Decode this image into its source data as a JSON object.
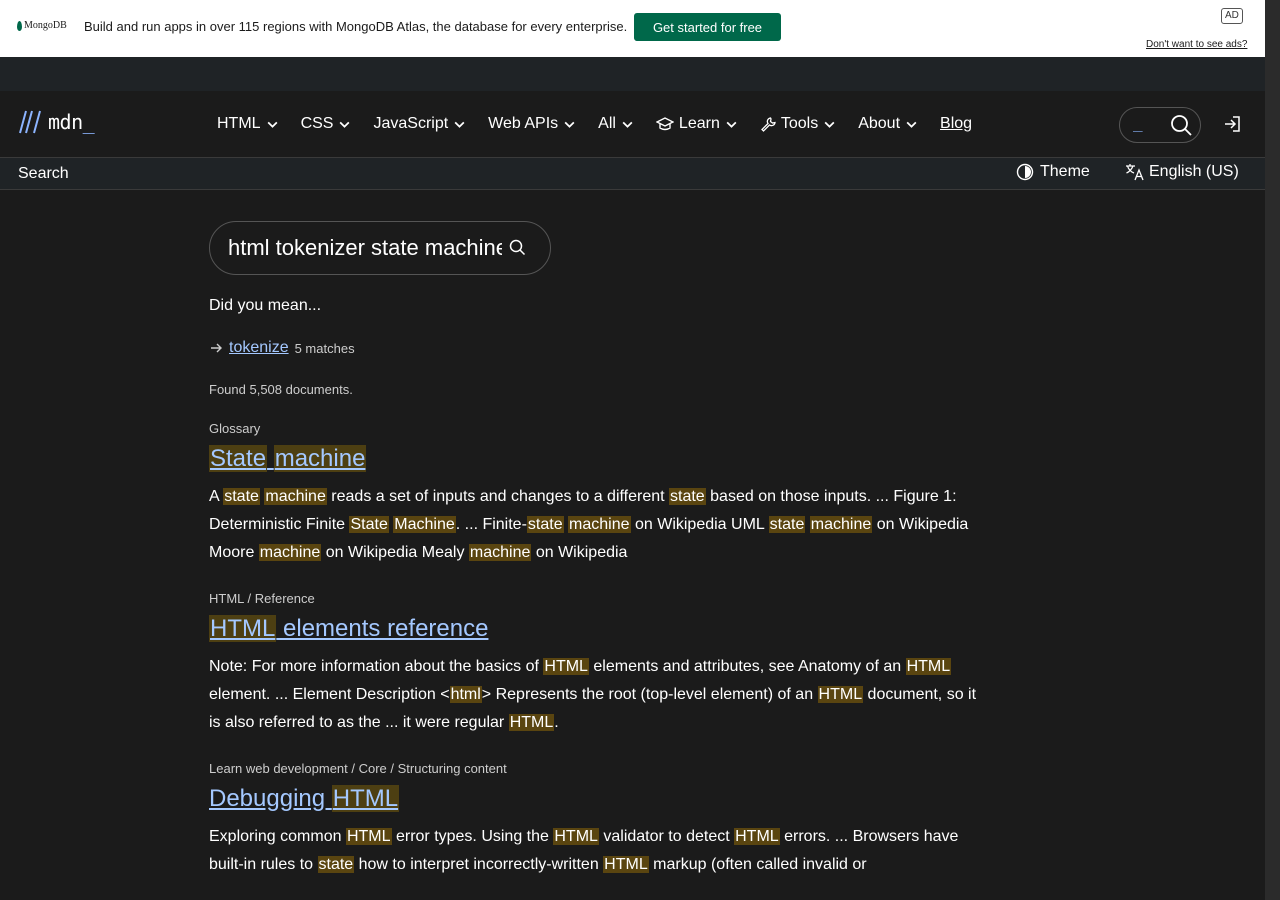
{
  "ad": {
    "logo_text": "MongoDB",
    "message": "Build and run apps in over 115 regions with MongoDB Atlas, the database for every enterprise.",
    "cta_label": "Get started for free",
    "badge": "AD",
    "dismiss_label": "Don't want to see ads?"
  },
  "nav": {
    "logo_text": "mdn",
    "logo_suffix": "_",
    "items": [
      {
        "label": "HTML",
        "icon": "chevron-down-icon"
      },
      {
        "label": "CSS",
        "icon": "chevron-down-icon"
      },
      {
        "label": "JavaScript",
        "icon": "chevron-down-icon"
      },
      {
        "label": "Web APIs",
        "icon": "chevron-down-icon"
      },
      {
        "label": "All",
        "icon": "chevron-down-icon"
      },
      {
        "label": "Learn",
        "icon": "chevron-down-icon"
      },
      {
        "label": "Tools",
        "icon": "chevron-down-icon"
      },
      {
        "label": "About",
        "icon": "chevron-down-icon"
      },
      {
        "label": "Blog"
      }
    ],
    "search_cursor": "_"
  },
  "subbar": {
    "page_label": "Search",
    "theme_label": "Theme",
    "language_label": "English (US)"
  },
  "search": {
    "query": "html tokenizer state machine",
    "did_you_mean": "Did you mean...",
    "suggestion": "tokenize",
    "suggestion_count": "5 matches",
    "found": "Found 5,508 documents."
  },
  "results": [
    {
      "crumb": "Glossary",
      "title_parts": [
        {
          "t": "State",
          "m": true
        },
        {
          "t": " ",
          "m": false
        },
        {
          "t": "machine",
          "m": true
        }
      ],
      "snippet_parts": [
        {
          "t": "A ",
          "m": false
        },
        {
          "t": "state",
          "m": true
        },
        {
          "t": " ",
          "m": false
        },
        {
          "t": "machine",
          "m": true
        },
        {
          "t": " reads a set of inputs and changes to a different ",
          "m": false
        },
        {
          "t": "state",
          "m": true
        },
        {
          "t": " based on those inputs. ... Figure 1: Deterministic Finite ",
          "m": false
        },
        {
          "t": "State",
          "m": true
        },
        {
          "t": " ",
          "m": false
        },
        {
          "t": "Machine",
          "m": true
        },
        {
          "t": ". ... Finite-",
          "m": false
        },
        {
          "t": "state",
          "m": true
        },
        {
          "t": " ",
          "m": false
        },
        {
          "t": "machine",
          "m": true
        },
        {
          "t": " on Wikipedia UML ",
          "m": false
        },
        {
          "t": "state",
          "m": true
        },
        {
          "t": " ",
          "m": false
        },
        {
          "t": "machine",
          "m": true
        },
        {
          "t": " on Wikipedia Moore ",
          "m": false
        },
        {
          "t": "machine",
          "m": true
        },
        {
          "t": " on Wikipedia Mealy ",
          "m": false
        },
        {
          "t": "machine",
          "m": true
        },
        {
          "t": " on Wikipedia",
          "m": false
        }
      ]
    },
    {
      "crumb": "HTML / Reference",
      "title_parts": [
        {
          "t": "HTML",
          "m": true
        },
        {
          "t": " elements reference",
          "m": false
        }
      ],
      "snippet_parts": [
        {
          "t": "Note: For more information about the basics of ",
          "m": false
        },
        {
          "t": "HTML",
          "m": true
        },
        {
          "t": " elements and attributes, see Anatomy of an ",
          "m": false
        },
        {
          "t": "HTML",
          "m": true
        },
        {
          "t": " element. ... Element Description <",
          "m": false
        },
        {
          "t": "html",
          "m": true
        },
        {
          "t": "> Represents the root (top-level element) of an ",
          "m": false
        },
        {
          "t": "HTML",
          "m": true
        },
        {
          "t": " document, so it is also referred to as the ... it were regular ",
          "m": false
        },
        {
          "t": "HTML",
          "m": true
        },
        {
          "t": ".",
          "m": false
        }
      ]
    },
    {
      "crumb": "Learn web development / Core / Structuring content",
      "title_parts": [
        {
          "t": "Debugging ",
          "m": false
        },
        {
          "t": "HTML",
          "m": true
        }
      ],
      "snippet_parts": [
        {
          "t": "Exploring common ",
          "m": false
        },
        {
          "t": "HTML",
          "m": true
        },
        {
          "t": " error types. Using the ",
          "m": false
        },
        {
          "t": "HTML",
          "m": true
        },
        {
          "t": " validator to detect ",
          "m": false
        },
        {
          "t": "HTML",
          "m": true
        },
        {
          "t": " errors. ... Browsers have built-in rules to ",
          "m": false
        },
        {
          "t": "state",
          "m": true
        },
        {
          "t": " how to interpret incorrectly-written ",
          "m": false
        },
        {
          "t": "HTML",
          "m": true
        },
        {
          "t": " markup (often called invalid or",
          "m": false
        }
      ]
    }
  ]
}
